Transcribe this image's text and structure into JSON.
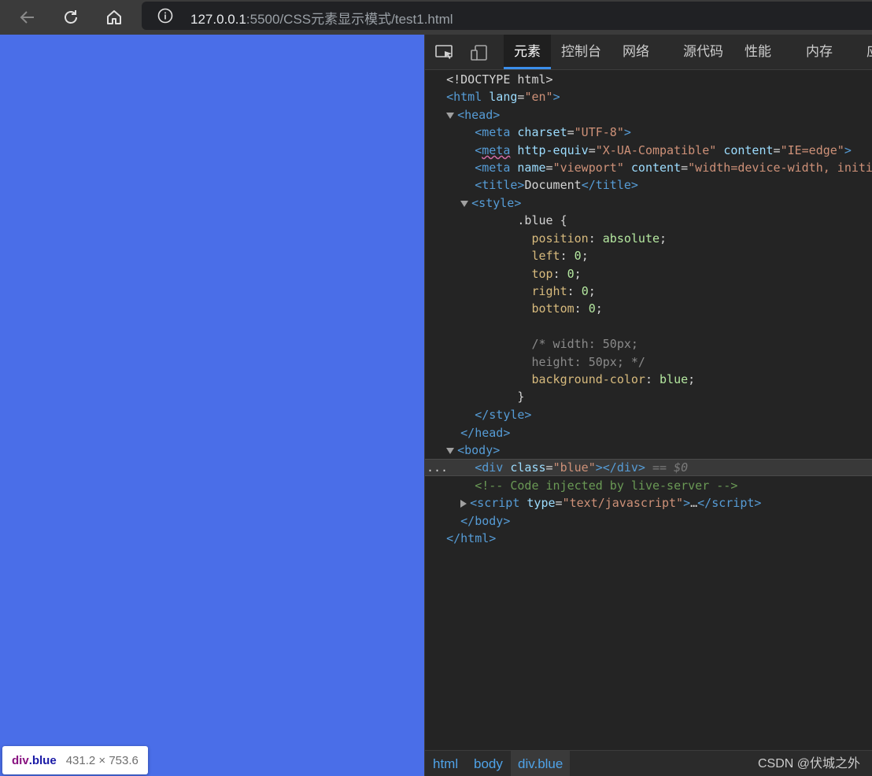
{
  "browser": {
    "url_host": "127.0.0.1",
    "url_rest": ":5500/CSS元素显示模式/test1.html",
    "back_icon": "back-arrow-icon",
    "reload_icon": "reload-icon",
    "home_icon": "home-icon",
    "info_icon": "info-icon"
  },
  "viewport": {
    "background": "#4a6ee8",
    "tooltip": {
      "tag": "div",
      "cls": ".blue",
      "size": "431.2 × 753.6"
    }
  },
  "devtools": {
    "tabs": [
      "元素",
      "控制台",
      "网络",
      "源代码",
      "性能",
      "内存",
      "应"
    ],
    "active_tab": "元素",
    "breadcrumbs": [
      "html",
      "body",
      "div.blue"
    ],
    "watermark": "CSDN @伏城之外",
    "dom": {
      "doctype": "<!DOCTYPE html>",
      "html_lang": "\"en\"",
      "meta_charset": "\"UTF-8\"",
      "meta_http_equiv": "\"X-UA-Compatible\"",
      "meta_content_edge": "\"IE=edge\"",
      "meta_name": "\"viewport\"",
      "meta_viewport_content": "\"width=device-width, initi",
      "title_text": "Document",
      "css_selector": ".blue {",
      "css_rules": [
        {
          "prop": "position",
          "val": "absolute"
        },
        {
          "prop": "left",
          "val": "0"
        },
        {
          "prop": "top",
          "val": "0"
        },
        {
          "prop": "right",
          "val": "0"
        },
        {
          "prop": "bottom",
          "val": "0"
        }
      ],
      "css_comment_1": "/* width: 50px;",
      "css_comment_2": "height: 50px; */",
      "css_bg_prop": "background-color",
      "css_bg_val": "blue",
      "div_class": "\"blue\"",
      "selected_marker": "== $0",
      "comment": "<!-- Code injected by live-server -->",
      "script_type": "\"text/javascript\""
    }
  }
}
